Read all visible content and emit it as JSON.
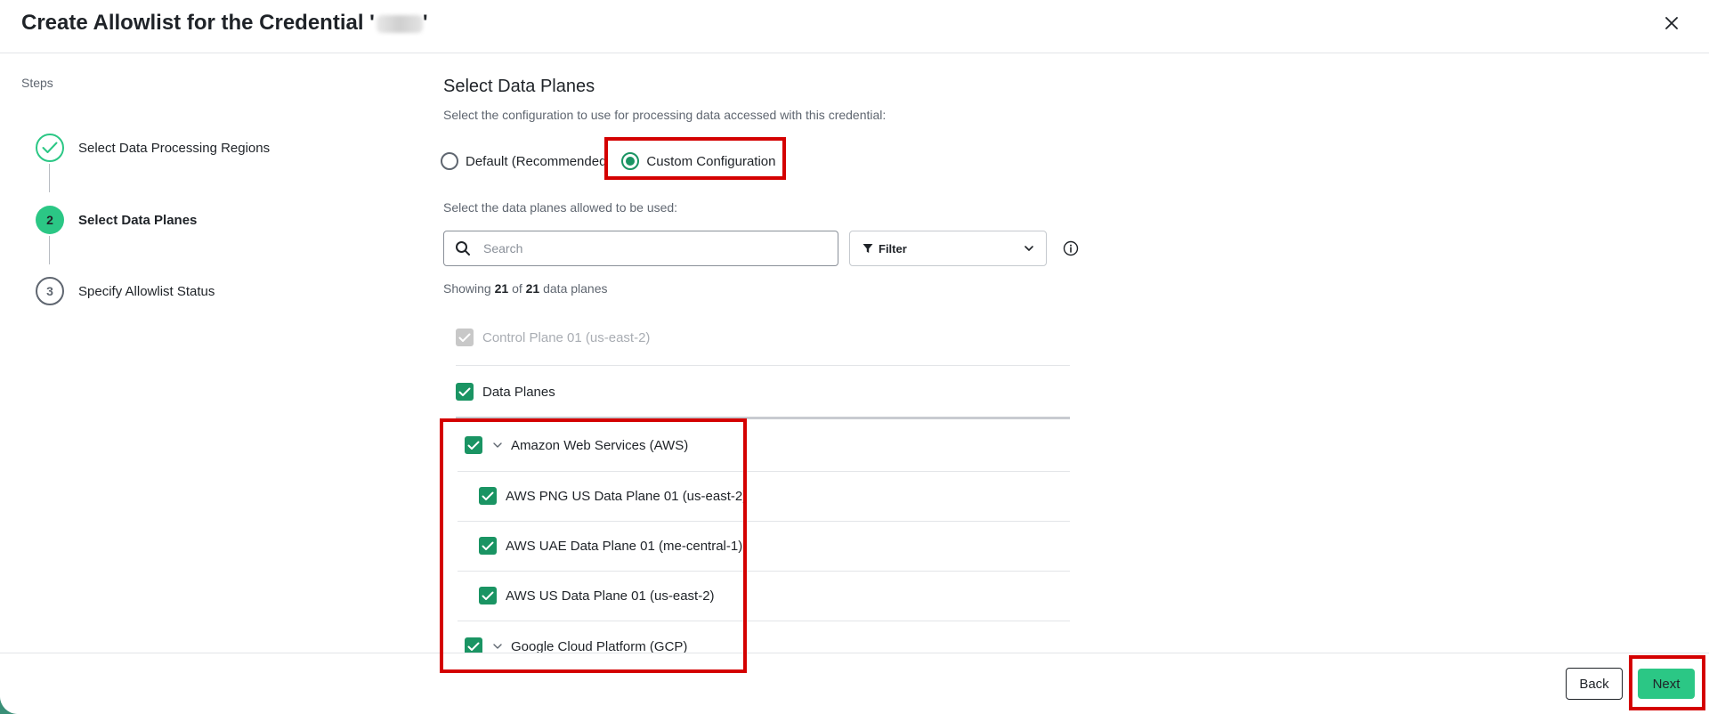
{
  "header": {
    "title": "Create Allowlist for the Credential '",
    "title_suffix": "'",
    "close_icon": "close-icon"
  },
  "steps": {
    "heading": "Steps",
    "items": [
      {
        "number": "",
        "label": "Select Data Processing Regions",
        "status": "complete"
      },
      {
        "number": "2",
        "label": "Select Data Planes",
        "status": "active"
      },
      {
        "number": "3",
        "label": "Specify Allowlist Status",
        "status": "pending"
      }
    ]
  },
  "main": {
    "title": "Select Data Planes",
    "config_prompt": "Select the configuration to use for processing data accessed with this credential:",
    "radio_options": [
      {
        "label": "Default (Recommended",
        "checked": false
      },
      {
        "label": "Custom Configuration",
        "checked": true
      }
    ],
    "planes_prompt": "Select the data planes allowed to be used:",
    "search": {
      "placeholder": "Search",
      "value": ""
    },
    "filter": {
      "label": "Filter"
    },
    "showing": {
      "prefix": "Showing",
      "shown": "21",
      "of": "of",
      "total": "21",
      "suffix": "data planes"
    },
    "list": [
      {
        "label": "Control Plane 01 (us-east-2)",
        "checked": true,
        "disabled": true
      },
      {
        "label": "Data Planes",
        "checked": true
      },
      {
        "label": "Amazon Web Services (AWS)",
        "checked": true,
        "group": true
      },
      {
        "label": "AWS PNG US Data Plane 01 (us-east-2)",
        "checked": true
      },
      {
        "label": "AWS UAE Data Plane 01 (me-central-1)",
        "checked": true
      },
      {
        "label": "AWS US Data Plane 01 (us-east-2)",
        "checked": true
      },
      {
        "label": "Google Cloud Platform (GCP)",
        "checked": true,
        "group": true
      }
    ]
  },
  "footer": {
    "back_label": "Back",
    "next_label": "Next"
  },
  "colors": {
    "accent": "#2bc785",
    "checkbox": "#1a9463",
    "highlight": "#d40000"
  }
}
